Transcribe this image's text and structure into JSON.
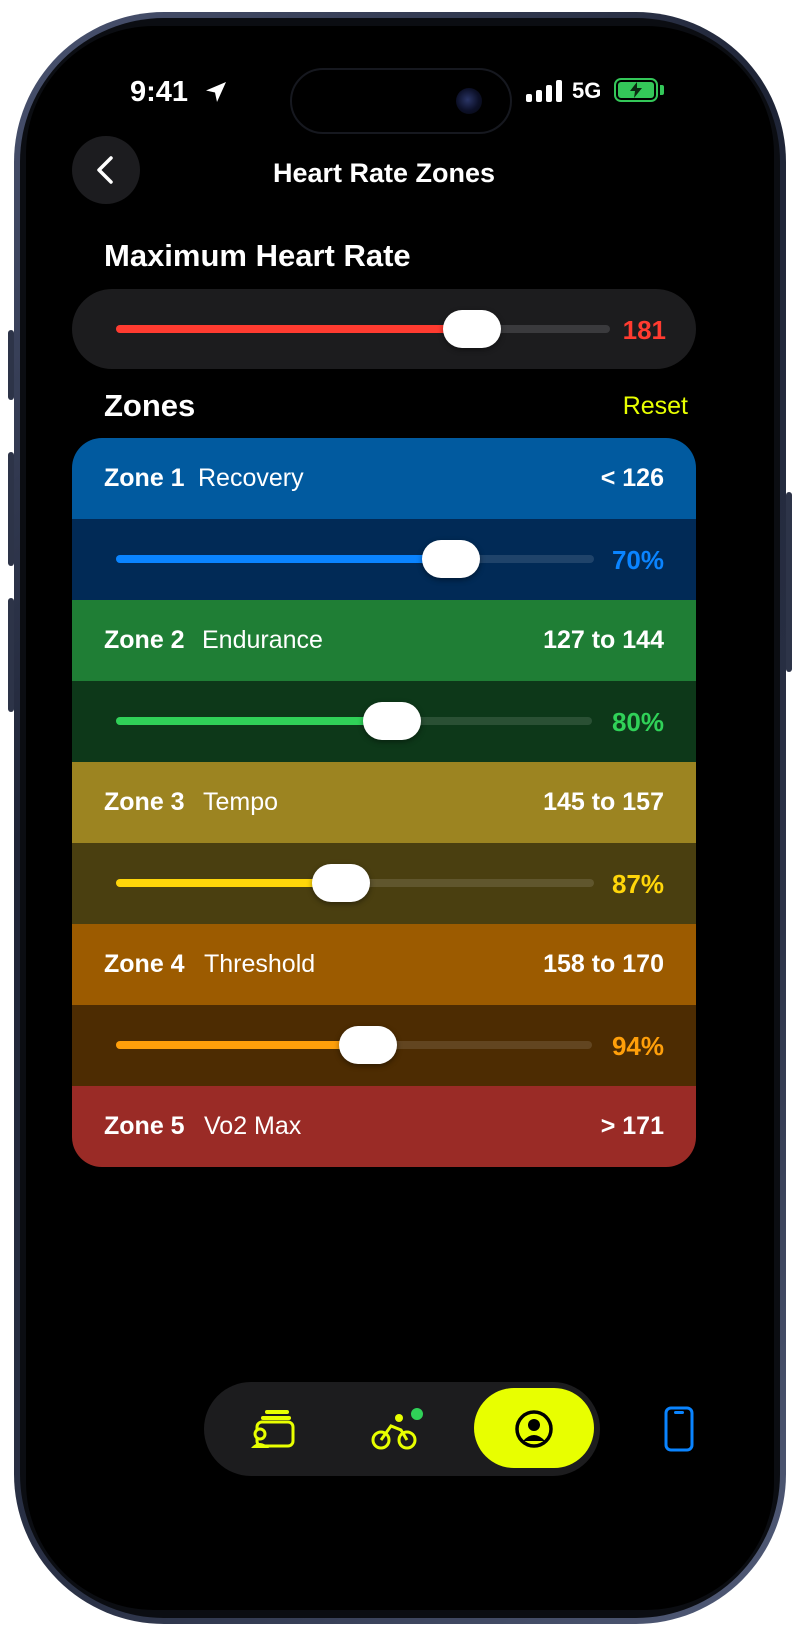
{
  "status_bar": {
    "time": "9:41",
    "network": "5G",
    "battery_color": "#34c759"
  },
  "header": {
    "title": "Heart Rate Zones",
    "back_icon": "chevron-left-icon"
  },
  "max_heart_rate": {
    "label": "Maximum Heart Rate",
    "value": "181",
    "fraction": 0.72,
    "color": "#ff3b30"
  },
  "zones_section": {
    "title": "Zones",
    "reset_label": "Reset",
    "reset_color": "#e8ff00"
  },
  "zones": [
    {
      "name": "Zone 1",
      "description": "Recovery",
      "range": "< 126",
      "percent_label": "70%",
      "fraction": 0.7,
      "head_color": "#015a9f",
      "slider_bg": "#012a56",
      "accent": "#0a84ff"
    },
    {
      "name": "Zone 2",
      "description": "Endurance",
      "range": "127 to 144",
      "percent_label": "80%",
      "fraction": 0.58,
      "head_color": "#1f7e35",
      "slider_bg": "#0d3819",
      "accent": "#30d158"
    },
    {
      "name": "Zone 3",
      "description": "Tempo",
      "range": "145 to 157",
      "percent_label": "87%",
      "fraction": 0.47,
      "head_color": "#9c8421",
      "slider_bg": "#4a3f10",
      "accent": "#ffd60a"
    },
    {
      "name": "Zone 4",
      "description": "Threshold",
      "range": "158 to 170",
      "percent_label": "94%",
      "fraction": 0.53,
      "head_color": "#9c5b00",
      "slider_bg": "#4d2c02",
      "accent": "#ff9f0a"
    },
    {
      "name": "Zone 5",
      "description": "Vo2 Max",
      "range": "> 171",
      "head_color": "#9a2b26"
    }
  ],
  "tab_bar": {
    "items": [
      {
        "icon": "cards-person-icon"
      },
      {
        "icon": "cyclist-icon",
        "badge_color": "#30d158"
      },
      {
        "icon": "profile-icon",
        "active": true
      }
    ],
    "active_color": "#e8ff00"
  },
  "device_icon": "phone-device-icon"
}
